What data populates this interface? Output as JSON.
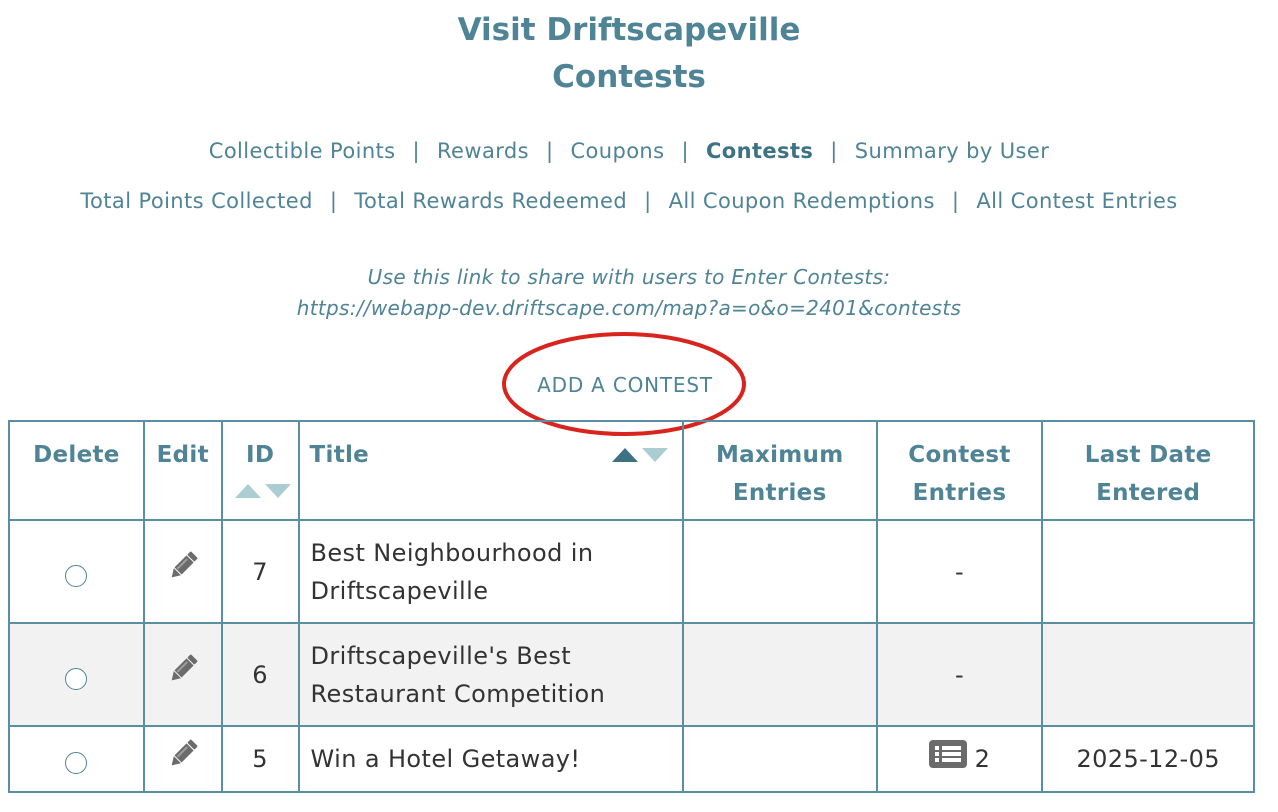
{
  "header": {
    "title_line1": "Visit Driftscapeville",
    "title_line2": "Contests"
  },
  "nav": {
    "row1": [
      {
        "label": "Collectible Points",
        "active": false
      },
      {
        "label": "Rewards",
        "active": false
      },
      {
        "label": "Coupons",
        "active": false
      },
      {
        "label": "Contests",
        "active": true
      },
      {
        "label": "Summary by User",
        "active": false
      }
    ],
    "row2": [
      {
        "label": "Total Points Collected"
      },
      {
        "label": "Total Rewards Redeemed"
      },
      {
        "label": "All Coupon Redemptions"
      },
      {
        "label": "All Contest Entries"
      }
    ],
    "separator": "|"
  },
  "share": {
    "text": "Use this link to share with users to Enter Contests:",
    "url": "https://webapp-dev.driftscape.com/map?a=o&o=2401&contests"
  },
  "add_contest": {
    "label": "ADD A CONTEST"
  },
  "table": {
    "headers": {
      "delete": "Delete",
      "edit": "Edit",
      "id": "ID",
      "title": "Title",
      "max_entries_1": "Maximum",
      "max_entries_2": "Entries",
      "contest_entries_1": "Contest",
      "contest_entries_2": "Entries",
      "last_date_1": "Last Date",
      "last_date_2": "Entered"
    },
    "rows": [
      {
        "id": "7",
        "title_1": "Best Neighbourhood in",
        "title_2": "Driftscapeville",
        "max_entries": "",
        "contest_entries": "-",
        "last_date": ""
      },
      {
        "id": "6",
        "title_1": "Driftscapeville's Best",
        "title_2": "Restaurant Competition",
        "max_entries": "",
        "contest_entries": "-",
        "last_date": ""
      },
      {
        "id": "5",
        "title_1": "Win a Hotel Getaway!",
        "title_2": "",
        "max_entries": "",
        "contest_entries": "2",
        "last_date": "2025-12-05"
      }
    ]
  },
  "icons": {
    "edit": "pencil-icon",
    "entries_list": "list-icon",
    "sort": "sort-arrows-icon"
  },
  "colors": {
    "accent": "#4f8396",
    "table_border": "#5a8fa3",
    "sort_active": "#3d7285",
    "sort_inactive": "#a9cdd1",
    "annotation_red": "#d9231d",
    "icon_gray": "#6b6b6b",
    "alt_row": "#f2f2f2"
  }
}
